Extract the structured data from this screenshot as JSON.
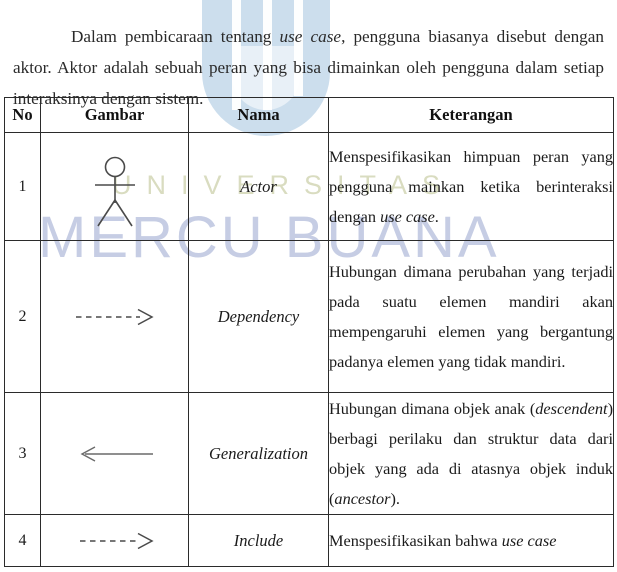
{
  "document": {
    "intro_paragraph": {
      "part1": "Dalam pembicaraan tentang ",
      "italic1": "use case",
      "part2": ", pengguna biasanya disebut dengan aktor. Aktor adalah sebuah peran yang bisa dimainkan oleh pengguna dalam setiap interaksinya dengan sistem."
    }
  },
  "watermark": {
    "line1": "UNIVERSITAS",
    "line2": "MERCU BUANA",
    "logo": "university-u-logo",
    "color_line1": "#d9dcc0",
    "color_line2": "#c6cde4",
    "color_logo": "#c3d8ea"
  },
  "table": {
    "headers": {
      "no": "No",
      "gambar": "Gambar",
      "nama": "Nama",
      "keterangan": "Keterangan"
    },
    "rows": [
      {
        "no": "1",
        "symbol": "actor-stick-figure-icon",
        "nama": "Actor",
        "keterangan": {
          "part1": "Menspesifikasikan himpuan peran yang pengguna mainkan ketika berinteraksi dengan ",
          "italic1": "use case",
          "part2": "."
        }
      },
      {
        "no": "2",
        "symbol": "dashed-open-arrow-right-icon",
        "nama": "Dependency",
        "keterangan": {
          "part1": "Hubungan dimana perubahan yang terjadi pada suatu elemen mandiri akan mempengaruhi elemen yang bergantung padanya elemen yang tidak mandiri.",
          "italic1": "",
          "part2": ""
        }
      },
      {
        "no": "3",
        "symbol": "solid-arrow-left-icon",
        "nama": "Generalization",
        "keterangan": {
          "part1": "Hubungan dimana objek anak (",
          "italic1": "descendent",
          "part2": ") berbagi perilaku dan struktur data dari objek yang ada di atasnya objek induk (",
          "italic2": "ancestor",
          "part3": ")."
        }
      },
      {
        "no": "4",
        "symbol": "dashed-open-arrow-right-icon",
        "nama": "Include",
        "keterangan": {
          "part1": "Menspesifikasikan bahwa ",
          "italic1": "use case",
          "part2": ""
        }
      }
    ]
  }
}
